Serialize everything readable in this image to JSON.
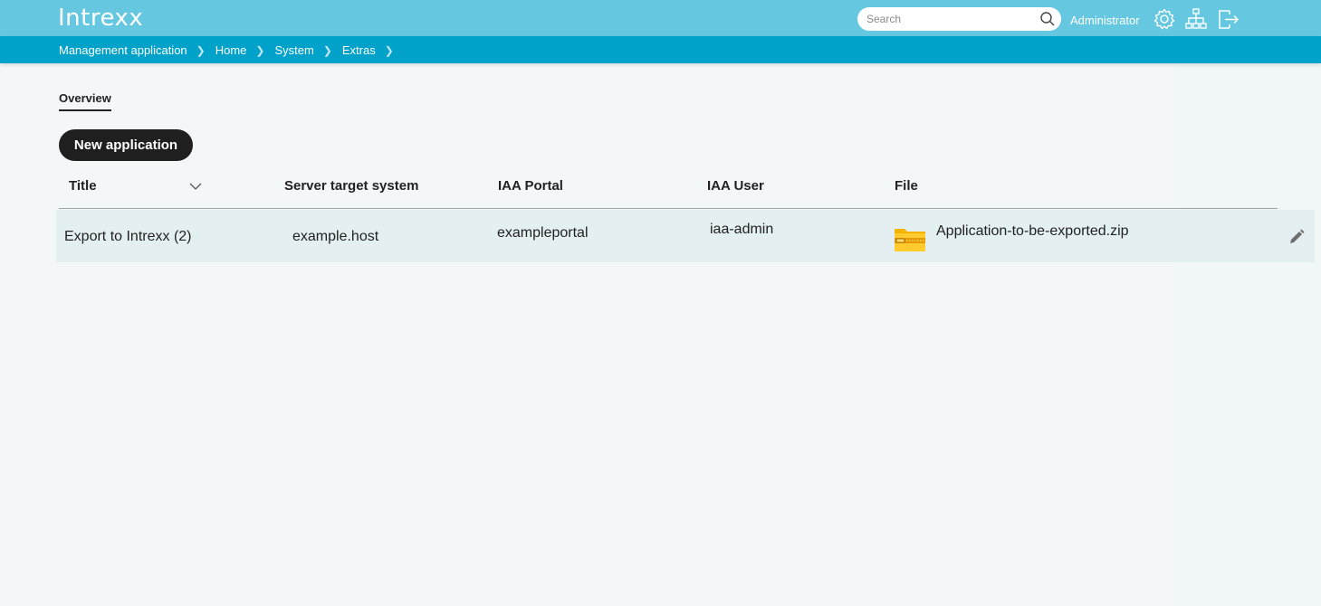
{
  "header": {
    "logo": "Intrexx",
    "search_placeholder": "Search",
    "user": "Administrator",
    "icons": [
      "settings-icon",
      "sitemap-icon",
      "logout-icon"
    ]
  },
  "breadcrumb": [
    "Management application",
    "Home",
    "System",
    "Extras"
  ],
  "tabs": [
    "Overview"
  ],
  "actions": {
    "new_application": "New application"
  },
  "table": {
    "columns": [
      "Title",
      "Server target system",
      "IAA Portal",
      "IAA User",
      "File"
    ],
    "rows": [
      {
        "title": "Export to Intrexx (2)",
        "server_target_system": "example.host",
        "iaa_portal": "exampleportal",
        "iaa_user": "iaa-admin",
        "file": "Application-to-be-exported.zip",
        "file_icon": "zip-folder-icon",
        "action_icon": "edit-pencil-icon"
      }
    ]
  },
  "colors": {
    "topbar": "#66c8e0",
    "crumbbar": "#00a2c9",
    "background": "#f1f6f7",
    "button": "#1f1f1f",
    "row": "#e4eff2"
  }
}
